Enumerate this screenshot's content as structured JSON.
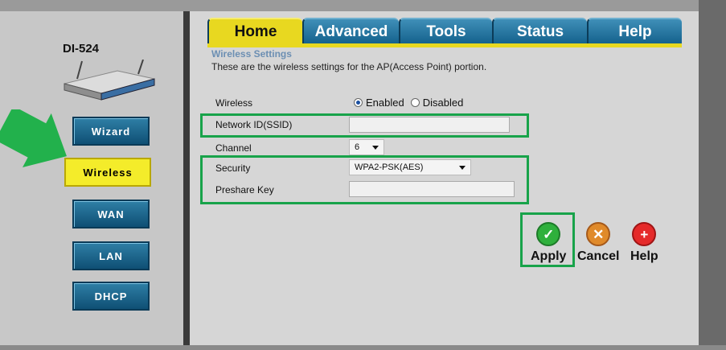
{
  "device": {
    "model": "DI-524"
  },
  "sidebar": {
    "items": [
      {
        "label": "Wizard",
        "active": false
      },
      {
        "label": "Wireless",
        "active": true
      },
      {
        "label": "WAN",
        "active": false
      },
      {
        "label": "LAN",
        "active": false
      },
      {
        "label": "DHCP",
        "active": false
      }
    ]
  },
  "tabs": [
    {
      "label": "Home",
      "active": true
    },
    {
      "label": "Advanced",
      "active": false
    },
    {
      "label": "Tools",
      "active": false
    },
    {
      "label": "Status",
      "active": false
    },
    {
      "label": "Help",
      "active": false
    }
  ],
  "section": {
    "title": "Wireless Settings",
    "description": "These are the wireless settings for the AP(Access Point) portion."
  },
  "form": {
    "wireless": {
      "label": "Wireless",
      "options": [
        "Enabled",
        "Disabled"
      ],
      "selected": "Enabled"
    },
    "ssid": {
      "label": "Network ID(SSID)",
      "value": ""
    },
    "channel": {
      "label": "Channel",
      "value": "6"
    },
    "security": {
      "label": "Security",
      "value": "WPA2-PSK(AES)"
    },
    "preshare": {
      "label": "Preshare Key",
      "value": ""
    }
  },
  "actions": {
    "apply": "Apply",
    "cancel": "Cancel",
    "help": "Help"
  },
  "colors": {
    "highlight": "#18a34a",
    "tab_active": "#e8d820",
    "nav_active": "#f4ec2a",
    "nav_blue": "#125f8a"
  }
}
